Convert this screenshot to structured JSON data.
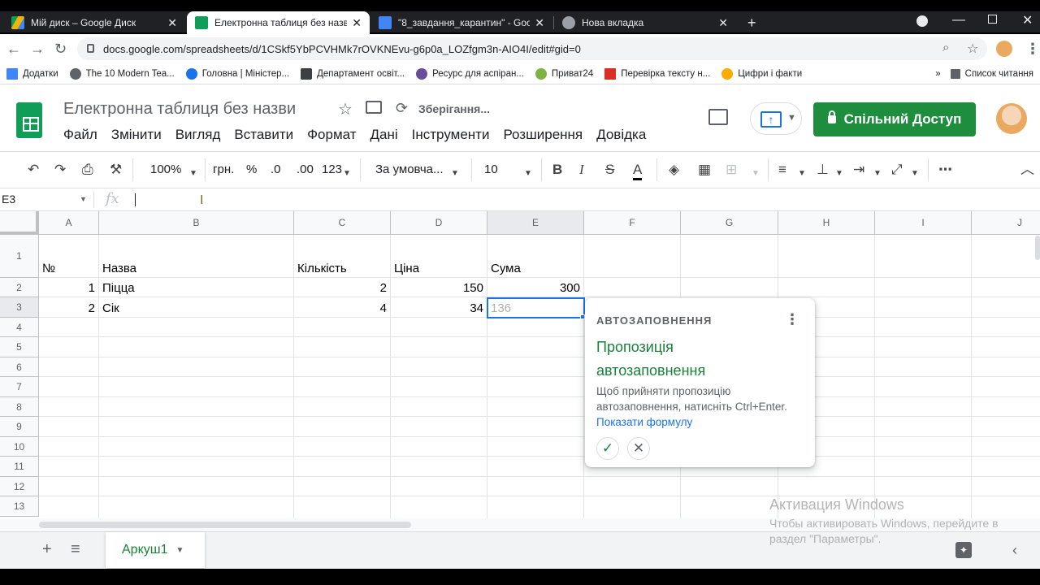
{
  "browser": {
    "tabs": [
      {
        "label": "Мій диск – Google Диск",
        "icon_color": "#4285f4"
      },
      {
        "label": "Електронна таблиця без назви",
        "icon_color": "#0f9d58",
        "active": true
      },
      {
        "label": "\"8_завдання_карантин\" - Google",
        "icon_color": "#4285f4"
      },
      {
        "label": "Нова вкладка",
        "icon_color": "#5f6368"
      }
    ],
    "url": "docs.google.com/spreadsheets/d/1CSkf5YbPCVHMk7rOVKNEvu-g6p0a_LOZfgm3n-AIO4I/edit#gid=0",
    "bookmarks": [
      {
        "label": "Додатки",
        "icon": "apps-grid-icon",
        "color": "#4285f4"
      },
      {
        "label": "The 10 Modern Tea...",
        "icon": "bookmark-icon",
        "color": "#5f6368"
      },
      {
        "label": "Головна | Міністер...",
        "icon": "bookmark-icon",
        "color": "#1a73e8"
      },
      {
        "label": "Департамент освіт...",
        "icon": "bookmark-icon",
        "color": "#3c4043"
      },
      {
        "label": "Ресурс для аспіран...",
        "icon": "bookmark-icon",
        "color": "#6a4c9c"
      },
      {
        "label": "Приват24",
        "icon": "bookmark-icon",
        "color": "#7cb342"
      },
      {
        "label": "Перевірка тексту н...",
        "icon": "bookmark-icon",
        "color": "#d93025"
      },
      {
        "label": "Цифри і факти",
        "icon": "bookmark-icon",
        "color": "#f9ab00"
      }
    ],
    "bookmarks_more": "»",
    "reading_list": "Список читання"
  },
  "doc": {
    "title": "Електронна таблиця без назви",
    "saving": "Зберігання...",
    "menu": [
      "Файл",
      "Змінити",
      "Вигляд",
      "Вставити",
      "Формат",
      "Дані",
      "Інструменти",
      "Розширення",
      "Довідка"
    ],
    "share": "Спільний Доступ"
  },
  "toolbar": {
    "zoom": "100%",
    "currency": "грн.",
    "percent": "%",
    "dec_decrease": ".0",
    "dec_increase": ".00",
    "format_more": "123",
    "font": "За умовча...",
    "font_size": "10"
  },
  "formula_bar": {
    "name_box": "E3",
    "fx": "fx",
    "value": ""
  },
  "grid": {
    "columns": [
      "A",
      "B",
      "C",
      "D",
      "E",
      "F",
      "G",
      "H",
      "I",
      "J"
    ],
    "rows": [
      "1",
      "2",
      "3",
      "4",
      "5",
      "6",
      "7",
      "8",
      "9",
      "10",
      "11",
      "12",
      "13"
    ],
    "selected_cell": "E3",
    "cells": {
      "A1": "№",
      "B1": "Назва",
      "C1": "Кількість",
      "D1": "Ціна",
      "E1": "Сума",
      "A2": "1",
      "B2": "Піцца",
      "C2": "2",
      "D2": "150",
      "E2": "300",
      "A3": "2",
      "B3": "Сік",
      "C3": "4",
      "D3": "34",
      "E3": "136"
    }
  },
  "autofill": {
    "heading": "АВТОЗАПОВНЕННЯ",
    "title": "Пропозиція автозаповнення",
    "body": "Щоб прийняти пропозицію автозаповнення, натисніть Ctrl+Enter.",
    "link": "Показати формулу"
  },
  "sheets": {
    "tab": "Аркуш1"
  },
  "watermark": {
    "line1": "Активация Windows",
    "line2": "Чтобы активировать Windows, перейдите в раздел \"Параметры\"."
  }
}
